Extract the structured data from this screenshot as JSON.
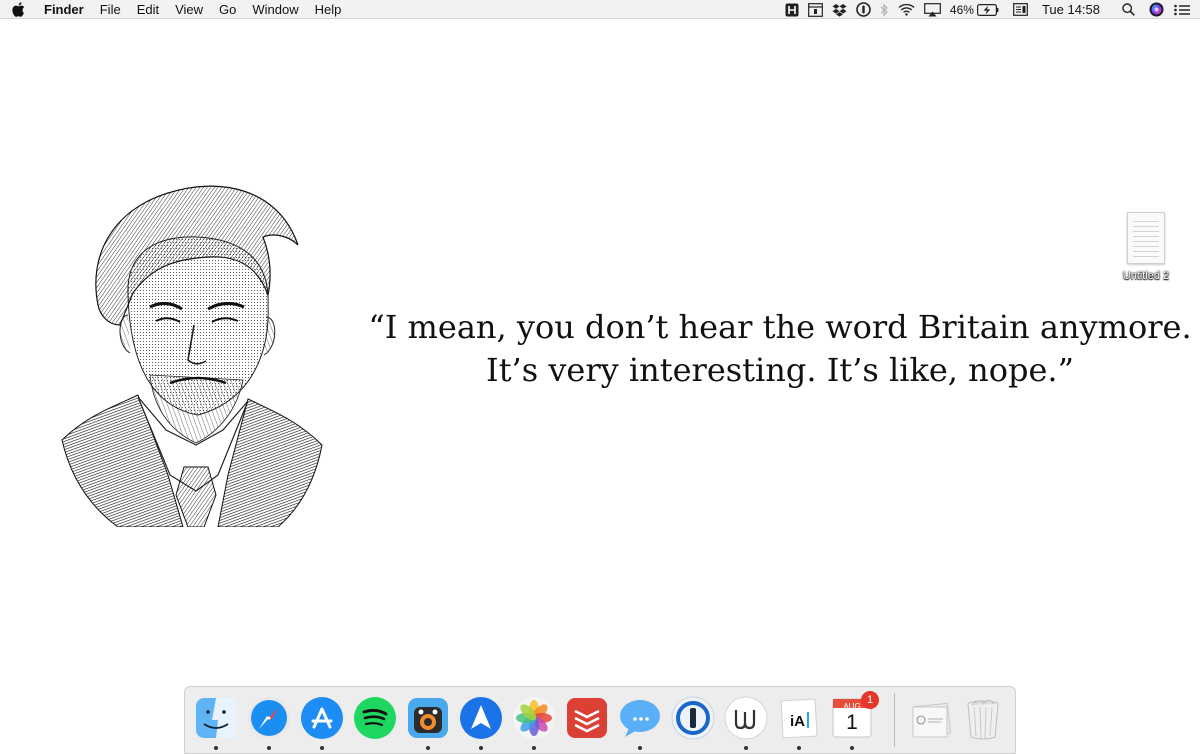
{
  "menubar": {
    "app_name": "Finder",
    "menus": [
      "File",
      "Edit",
      "View",
      "Go",
      "Window",
      "Help"
    ],
    "battery_percent": "46%",
    "clock": "Tue 14:58",
    "status_icons": [
      "h-icon",
      "window-icon",
      "dropbox-icon",
      "1password-icon",
      "bluetooth-icon",
      "wifi-icon",
      "airplay-icon",
      "battery-icon",
      "display-icon",
      "search-icon",
      "siri-icon",
      "notification-center-icon"
    ]
  },
  "wallpaper": {
    "quote_line1": "“I mean, you don’t hear the word Britain anymore.",
    "quote_line2": "It’s very interesting. It’s like, nope.”"
  },
  "desktop": {
    "file_label": "Untitled 2"
  },
  "dock": {
    "apps": [
      {
        "name": "finder-icon",
        "running": true
      },
      {
        "name": "safari-icon",
        "running": true
      },
      {
        "name": "app-store-icon",
        "running": true
      },
      {
        "name": "spotify-icon",
        "running": false
      },
      {
        "name": "tweetbot-icon",
        "running": true
      },
      {
        "name": "spark-icon",
        "running": true
      },
      {
        "name": "photos-icon",
        "running": true
      },
      {
        "name": "todoist-icon",
        "running": false
      },
      {
        "name": "messages-icon",
        "running": true
      },
      {
        "name": "1password-icon",
        "running": false
      },
      {
        "name": "wunderlist-icon",
        "running": true
      },
      {
        "name": "ia-writer-icon",
        "running": true
      },
      {
        "name": "calendar-icon",
        "running": true
      }
    ],
    "calendar_month": "AUG",
    "calendar_day": "1",
    "calendar_badge": "1",
    "colors": {
      "safari": "#1b8ef2",
      "app_store": "#1d8cf5",
      "spotify": "#1ed760",
      "todoist": "#db4035",
      "spark": "#1a73e8",
      "badge": "#e5362c"
    }
  }
}
